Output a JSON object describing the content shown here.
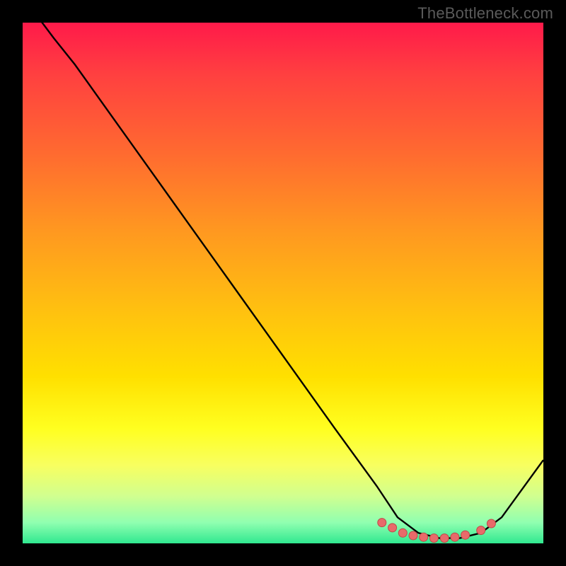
{
  "watermark": "TheBottleneck.com",
  "colors": {
    "line": "#000000",
    "dot_fill": "#e86a6a",
    "dot_stroke": "#c04848",
    "background": "#000000"
  },
  "chart_data": {
    "type": "line",
    "title": "",
    "xlabel": "",
    "ylabel": "",
    "xlim": [
      0,
      100
    ],
    "ylim": [
      0,
      100
    ],
    "grid": false,
    "legend": false,
    "series": [
      {
        "name": "curve",
        "x": [
          0,
          6,
          10,
          20,
          30,
          40,
          50,
          60,
          68,
          72,
          76,
          80,
          84,
          88,
          92,
          100
        ],
        "y": [
          105,
          97,
          92,
          78,
          64,
          50,
          36,
          22,
          11,
          5,
          2,
          1,
          1,
          2,
          5,
          16
        ]
      }
    ],
    "dots": {
      "name": "highlight-dots",
      "x": [
        69,
        71,
        73,
        75,
        77,
        79,
        81,
        83,
        85,
        88,
        90
      ],
      "y": [
        4,
        3,
        2,
        1.5,
        1.2,
        1,
        1,
        1.2,
        1.6,
        2.5,
        3.8
      ]
    }
  }
}
